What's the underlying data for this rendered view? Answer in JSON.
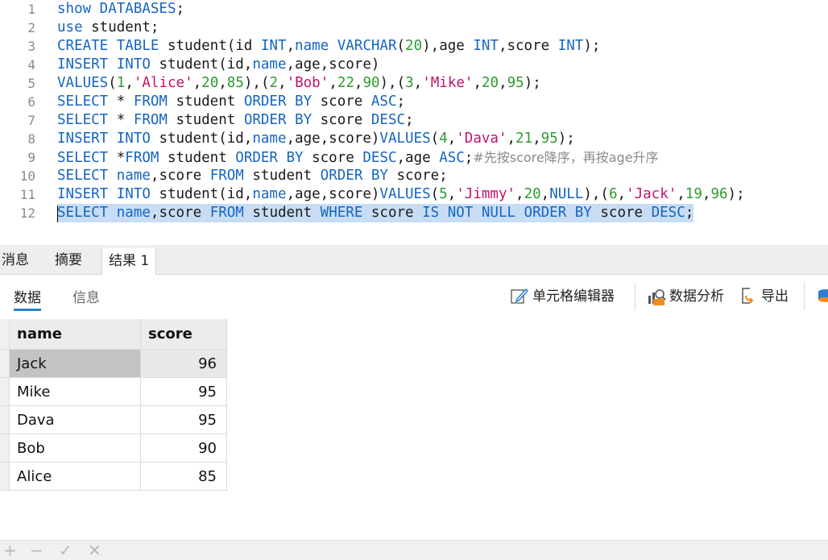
{
  "editor": {
    "lines": [
      {
        "num": "1",
        "tokens": [
          {
            "t": "show DATABASES",
            "c": "k"
          },
          {
            "t": ";",
            "c": ""
          }
        ]
      },
      {
        "num": "2",
        "tokens": [
          {
            "t": "use",
            "c": "k"
          },
          {
            "t": " student;",
            "c": ""
          }
        ]
      },
      {
        "num": "3",
        "tokens": [
          {
            "t": "CREATE TABLE",
            "c": "k"
          },
          {
            "t": " student(id ",
            "c": ""
          },
          {
            "t": "INT",
            "c": "k"
          },
          {
            "t": ",",
            "c": ""
          },
          {
            "t": "name",
            "c": "k"
          },
          {
            "t": " ",
            "c": ""
          },
          {
            "t": "VARCHAR",
            "c": "k"
          },
          {
            "t": "(",
            "c": ""
          },
          {
            "t": "20",
            "c": "n"
          },
          {
            "t": "),age ",
            "c": ""
          },
          {
            "t": "INT",
            "c": "k"
          },
          {
            "t": ",score ",
            "c": ""
          },
          {
            "t": "INT",
            "c": "k"
          },
          {
            "t": ");",
            "c": ""
          }
        ]
      },
      {
        "num": "4",
        "tokens": [
          {
            "t": "INSERT INTO",
            "c": "k"
          },
          {
            "t": " student(id,",
            "c": ""
          },
          {
            "t": "name",
            "c": "k"
          },
          {
            "t": ",age,score)",
            "c": ""
          }
        ]
      },
      {
        "num": "5",
        "tokens": [
          {
            "t": "VALUES",
            "c": "k"
          },
          {
            "t": "(",
            "c": ""
          },
          {
            "t": "1",
            "c": "n"
          },
          {
            "t": ",",
            "c": ""
          },
          {
            "t": "'Alice'",
            "c": "s"
          },
          {
            "t": ",",
            "c": ""
          },
          {
            "t": "20",
            "c": "n"
          },
          {
            "t": ",",
            "c": ""
          },
          {
            "t": "85",
            "c": "n"
          },
          {
            "t": "),(",
            "c": ""
          },
          {
            "t": "2",
            "c": "n"
          },
          {
            "t": ",",
            "c": ""
          },
          {
            "t": "'Bob'",
            "c": "s"
          },
          {
            "t": ",",
            "c": ""
          },
          {
            "t": "22",
            "c": "n"
          },
          {
            "t": ",",
            "c": ""
          },
          {
            "t": "90",
            "c": "n"
          },
          {
            "t": "),(",
            "c": ""
          },
          {
            "t": "3",
            "c": "n"
          },
          {
            "t": ",",
            "c": ""
          },
          {
            "t": "'Mike'",
            "c": "s"
          },
          {
            "t": ",",
            "c": ""
          },
          {
            "t": "20",
            "c": "n"
          },
          {
            "t": ",",
            "c": ""
          },
          {
            "t": "95",
            "c": "n"
          },
          {
            "t": ");",
            "c": ""
          }
        ]
      },
      {
        "num": "6",
        "tokens": [
          {
            "t": "SELECT",
            "c": "k"
          },
          {
            "t": " * ",
            "c": ""
          },
          {
            "t": "FROM",
            "c": "k"
          },
          {
            "t": " student ",
            "c": ""
          },
          {
            "t": "ORDER BY",
            "c": "k"
          },
          {
            "t": " score ",
            "c": ""
          },
          {
            "t": "ASC",
            "c": "k"
          },
          {
            "t": ";",
            "c": ""
          }
        ]
      },
      {
        "num": "7",
        "tokens": [
          {
            "t": "SELECT",
            "c": "k"
          },
          {
            "t": " * ",
            "c": ""
          },
          {
            "t": "FROM",
            "c": "k"
          },
          {
            "t": " student ",
            "c": ""
          },
          {
            "t": "ORDER BY",
            "c": "k"
          },
          {
            "t": " score ",
            "c": ""
          },
          {
            "t": "DESC",
            "c": "k"
          },
          {
            "t": ";",
            "c": ""
          }
        ]
      },
      {
        "num": "8",
        "tokens": [
          {
            "t": "INSERT INTO",
            "c": "k"
          },
          {
            "t": " student(id,",
            "c": ""
          },
          {
            "t": "name",
            "c": "k"
          },
          {
            "t": ",age,score)",
            "c": ""
          },
          {
            "t": "VALUES",
            "c": "k"
          },
          {
            "t": "(",
            "c": ""
          },
          {
            "t": "4",
            "c": "n"
          },
          {
            "t": ",",
            "c": ""
          },
          {
            "t": "'Dava'",
            "c": "s"
          },
          {
            "t": ",",
            "c": ""
          },
          {
            "t": "21",
            "c": "n"
          },
          {
            "t": ",",
            "c": ""
          },
          {
            "t": "95",
            "c": "n"
          },
          {
            "t": ");",
            "c": ""
          }
        ]
      },
      {
        "num": "9",
        "tokens": [
          {
            "t": "SELECT",
            "c": "k"
          },
          {
            "t": " *",
            "c": ""
          },
          {
            "t": "FROM",
            "c": "k"
          },
          {
            "t": " student ",
            "c": ""
          },
          {
            "t": "ORDER BY",
            "c": "k"
          },
          {
            "t": " score ",
            "c": ""
          },
          {
            "t": "DESC",
            "c": "k"
          },
          {
            "t": ",age ",
            "c": ""
          },
          {
            "t": "ASC",
            "c": "k"
          },
          {
            "t": ";",
            "c": ""
          },
          {
            "t": "#先按score降序，再按age升序",
            "c": "c"
          }
        ]
      },
      {
        "num": "10",
        "tokens": [
          {
            "t": "SELECT",
            "c": "k"
          },
          {
            "t": " ",
            "c": ""
          },
          {
            "t": "name",
            "c": "k"
          },
          {
            "t": ",score ",
            "c": ""
          },
          {
            "t": "FROM",
            "c": "k"
          },
          {
            "t": " student ",
            "c": ""
          },
          {
            "t": "ORDER BY",
            "c": "k"
          },
          {
            "t": " score;",
            "c": ""
          }
        ]
      },
      {
        "num": "11",
        "tokens": [
          {
            "t": "INSERT INTO",
            "c": "k"
          },
          {
            "t": " student(id,",
            "c": ""
          },
          {
            "t": "name",
            "c": "k"
          },
          {
            "t": ",age,score)",
            "c": ""
          },
          {
            "t": "VALUES",
            "c": "k"
          },
          {
            "t": "(",
            "c": ""
          },
          {
            "t": "5",
            "c": "n"
          },
          {
            "t": ",",
            "c": ""
          },
          {
            "t": "'Jimmy'",
            "c": "s"
          },
          {
            "t": ",",
            "c": ""
          },
          {
            "t": "20",
            "c": "n"
          },
          {
            "t": ",",
            "c": ""
          },
          {
            "t": "NULL",
            "c": "k"
          },
          {
            "t": "),(",
            "c": ""
          },
          {
            "t": "6",
            "c": "n"
          },
          {
            "t": ",",
            "c": ""
          },
          {
            "t": "'Jack'",
            "c": "s"
          },
          {
            "t": ",",
            "c": ""
          },
          {
            "t": "19",
            "c": "n"
          },
          {
            "t": ",",
            "c": ""
          },
          {
            "t": "96",
            "c": "n"
          },
          {
            "t": ");",
            "c": ""
          }
        ]
      },
      {
        "num": "12",
        "selected": true,
        "tokens": [
          {
            "t": "SELECT",
            "c": "k"
          },
          {
            "t": " ",
            "c": ""
          },
          {
            "t": "name",
            "c": "k"
          },
          {
            "t": ",score ",
            "c": ""
          },
          {
            "t": "FROM",
            "c": "k"
          },
          {
            "t": " student ",
            "c": ""
          },
          {
            "t": "WHERE",
            "c": "k"
          },
          {
            "t": " score ",
            "c": ""
          },
          {
            "t": "IS NOT NULL ORDER BY",
            "c": "k"
          },
          {
            "t": " score ",
            "c": ""
          },
          {
            "t": "DESC",
            "c": "k"
          },
          {
            "t": ";",
            "c": ""
          }
        ]
      }
    ]
  },
  "result_tabs": {
    "messages": "消息",
    "summary": "摘要",
    "result1": "结果 1"
  },
  "toolbar": {
    "data_tab": "数据",
    "info_tab": "信息",
    "cell_editor": "单元格编辑器",
    "data_analysis": "数据分析",
    "export": "导出"
  },
  "grid": {
    "columns": [
      "name",
      "score"
    ],
    "rows": [
      {
        "name": "Jack",
        "score": "96"
      },
      {
        "name": "Mike",
        "score": "95"
      },
      {
        "name": "Dava",
        "score": "95"
      },
      {
        "name": "Bob",
        "score": "90"
      },
      {
        "name": "Alice",
        "score": "85"
      }
    ]
  },
  "bottom_bar": {
    "add": "+",
    "remove": "−",
    "apply": "✓",
    "discard": "✕"
  },
  "colors": {
    "keyword": "#1565c0",
    "number": "#2e9b2e",
    "string": "#c0146b",
    "comment": "#8a8a8a",
    "selection": "#c8ddf4",
    "accent": "#2a7fd4"
  }
}
